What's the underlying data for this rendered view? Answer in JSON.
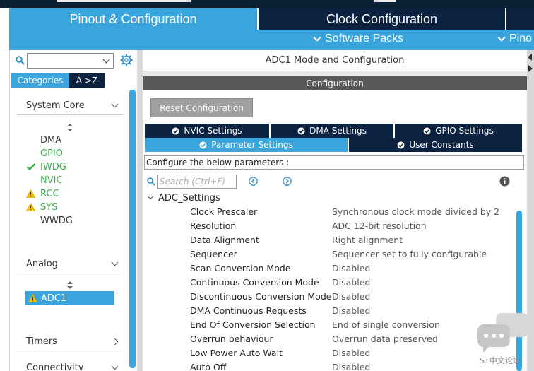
{
  "main_tabs": {
    "pinout": "Pinout & Configuration",
    "clock": "Clock Configuration"
  },
  "subbar": {
    "software_packs": "Software Packs",
    "pinout_short": "Pino"
  },
  "left": {
    "categories_tab": "Categories",
    "az_tab": "A->Z",
    "groups": {
      "system_core": "System Core",
      "analog": "Analog",
      "timers": "Timers",
      "connectivity": "Connectivity"
    },
    "system_core_items": [
      {
        "label": "DMA",
        "status": "none",
        "color": "dark"
      },
      {
        "label": "GPIO",
        "status": "none",
        "color": "green"
      },
      {
        "label": "IWDG",
        "status": "check",
        "color": "green"
      },
      {
        "label": "NVIC",
        "status": "none",
        "color": "green"
      },
      {
        "label": "RCC",
        "status": "warning",
        "color": "green"
      },
      {
        "label": "SYS",
        "status": "warning",
        "color": "green"
      },
      {
        "label": "WWDG",
        "status": "none",
        "color": "dark"
      }
    ],
    "analog_items": [
      {
        "label": "ADC1",
        "status": "warning",
        "selected": true
      }
    ]
  },
  "panel": {
    "title": "ADC1 Mode and Configuration",
    "configuration": "Configuration",
    "reset_button": "Reset Configuration",
    "tabs_row1": [
      "NVIC Settings",
      "DMA Settings",
      "GPIO Settings"
    ],
    "tabs_row2": [
      "Parameter Settings",
      "User Constants"
    ],
    "configure_label": "Configure the below parameters :",
    "search_placeholder": "Search (Ctrl+F)",
    "section": "ADC_Settings",
    "params": [
      {
        "name": "Clock Prescaler",
        "value": "Synchronous clock mode divided by 2"
      },
      {
        "name": "Resolution",
        "value": "ADC 12-bit resolution"
      },
      {
        "name": "Data Alignment",
        "value": "Right alignment"
      },
      {
        "name": "Sequencer",
        "value": "Sequencer set to fully configurable"
      },
      {
        "name": "Scan Conversion Mode",
        "value": "Disabled"
      },
      {
        "name": "Continuous Conversion Mode",
        "value": "Disabled"
      },
      {
        "name": "Discontinuous Conversion Mode",
        "value": "Disabled"
      },
      {
        "name": "DMA Continuous Requests",
        "value": "Disabled"
      },
      {
        "name": "End Of Conversion Selection",
        "value": "End of single conversion"
      },
      {
        "name": "Overrun behaviour",
        "value": "Overrun data preserved"
      },
      {
        "name": "Low Power Auto Wait",
        "value": "Disabled"
      },
      {
        "name": "Auto Off",
        "value": "Disabled"
      }
    ]
  },
  "watermark": "ST中文论坛",
  "colors": {
    "accent_blue": "#3aa5dc",
    "navy": "#0b2340",
    "ok_green": "#3cae4c",
    "warning_yellow": "#f5c400"
  }
}
